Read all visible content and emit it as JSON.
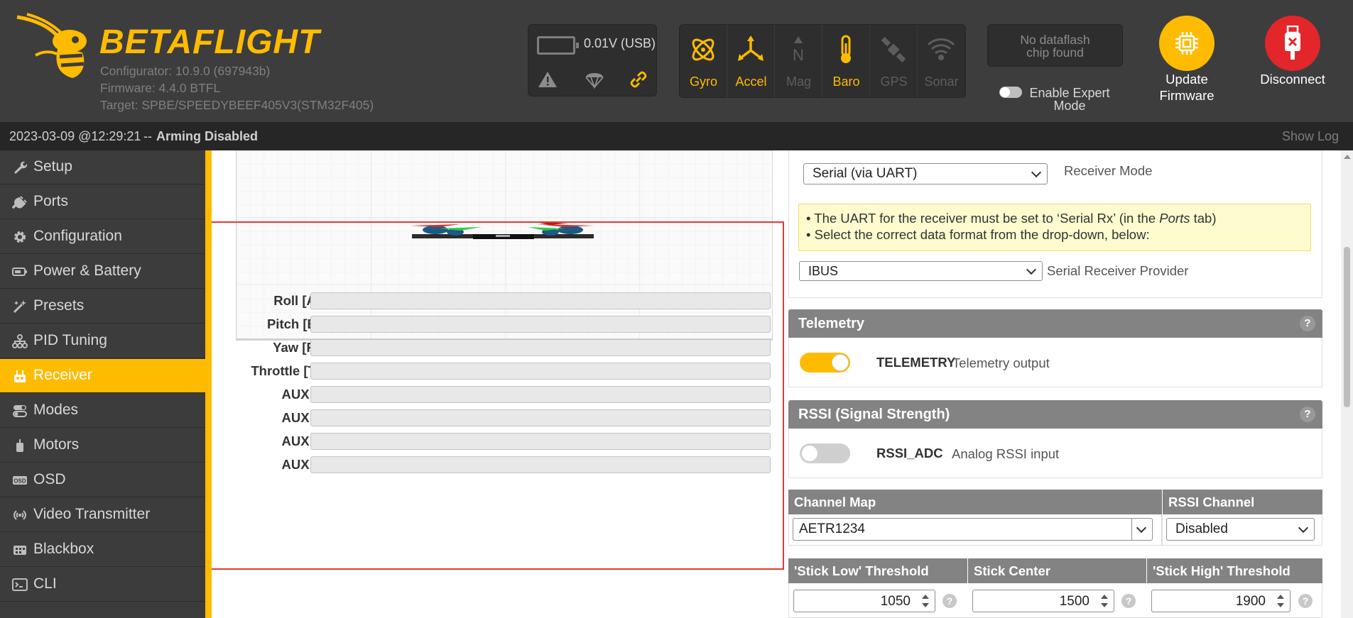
{
  "header": {
    "brand": "BETAFLIGHT",
    "configurator": "Configurator: 10.9.0 (697943b)",
    "firmware": "Firmware: 4.4.0 BTFL",
    "target": "Target: SPBE/SPEEDYBEEF405V3(STM32F405)",
    "battery": "0.01V (USB)",
    "status_icons": [
      "warning-icon",
      "failsafe-parachute-icon",
      "link-icon"
    ],
    "sensors": [
      {
        "label": "Gyro",
        "active": true,
        "icon": "gyro-icon"
      },
      {
        "label": "Accel",
        "active": true,
        "icon": "accel-icon"
      },
      {
        "label": "Mag",
        "active": false,
        "icon": "mag-icon"
      },
      {
        "label": "Baro",
        "active": true,
        "icon": "baro-icon"
      },
      {
        "label": "GPS",
        "active": false,
        "icon": "gps-icon"
      },
      {
        "label": "Sonar",
        "active": false,
        "icon": "sonar-icon"
      }
    ],
    "dataflash_line1": "No dataflash",
    "dataflash_line2": "chip found",
    "expert_mode_line1": "Enable Expert",
    "expert_mode_line2": "Mode",
    "update_firmware_line1": "Update",
    "update_firmware_line2": "Firmware",
    "disconnect": "Disconnect",
    "colors": {
      "accent": "#ffbb00",
      "disconnect": "#e2262a",
      "header_bg": "#3d3d3d"
    }
  },
  "statusbar": {
    "date": "2023-03-09 @12:29:21",
    "separator": "--",
    "arming": "Arming Disabled",
    "show_log": "Show Log"
  },
  "sidebar": {
    "items": [
      {
        "label": "Setup",
        "icon": "wrench-icon"
      },
      {
        "label": "Ports",
        "icon": "plug-icon"
      },
      {
        "label": "Configuration",
        "icon": "gear-icon"
      },
      {
        "label": "Power & Battery",
        "icon": "battery-icon"
      },
      {
        "label": "Presets",
        "icon": "magic-wand-icon"
      },
      {
        "label": "PID Tuning",
        "icon": "pid-tree-icon"
      },
      {
        "label": "Receiver",
        "icon": "receiver-icon",
        "active": true
      },
      {
        "label": "Modes",
        "icon": "toggles-icon"
      },
      {
        "label": "Motors",
        "icon": "motor-icon"
      },
      {
        "label": "OSD",
        "icon": "osd-icon"
      },
      {
        "label": "Video Transmitter",
        "icon": "antenna-icon"
      },
      {
        "label": "Blackbox",
        "icon": "blackbox-icon"
      },
      {
        "label": "CLI",
        "icon": "terminal-icon"
      }
    ]
  },
  "channels": [
    {
      "label": "Roll [A]",
      "value": 0
    },
    {
      "label": "Pitch [E]",
      "value": 0
    },
    {
      "label": "Yaw [R]",
      "value": 0
    },
    {
      "label": "Throttle [T]",
      "value": 0
    },
    {
      "label": "AUX 1",
      "value": 0
    },
    {
      "label": "AUX 2",
      "value": 0
    },
    {
      "label": "AUX 3",
      "value": 0
    },
    {
      "label": "AUX 4",
      "value": 0
    }
  ],
  "receiver": {
    "mode_value": "Serial (via UART)",
    "mode_label": "Receiver Mode",
    "note_line1_pre": "• The UART for the receiver must be set to ‘Serial Rx’ (in the ",
    "note_line1_em": "Ports",
    "note_line1_post": " tab)",
    "note_line2": "• Select the correct data format from the drop-down, below:",
    "provider_value": "IBUS",
    "provider_label": "Serial Receiver Provider"
  },
  "telemetry": {
    "title": "Telemetry",
    "name": "TELEMETRY",
    "description": "Telemetry output",
    "enabled": true
  },
  "rssi": {
    "title": "RSSI (Signal Strength)",
    "name": "RSSI_ADC",
    "description": "Analog RSSI input",
    "enabled": false
  },
  "channel_map": {
    "header": "Channel Map",
    "value": "AETR1234",
    "rssi_header": "RSSI Channel",
    "rssi_value": "Disabled"
  },
  "stick": {
    "low_header": "'Stick Low' Threshold",
    "low_value": "1050",
    "center_header": "Stick Center",
    "center_value": "1500",
    "high_header": "'Stick High' Threshold",
    "high_value": "1900"
  }
}
